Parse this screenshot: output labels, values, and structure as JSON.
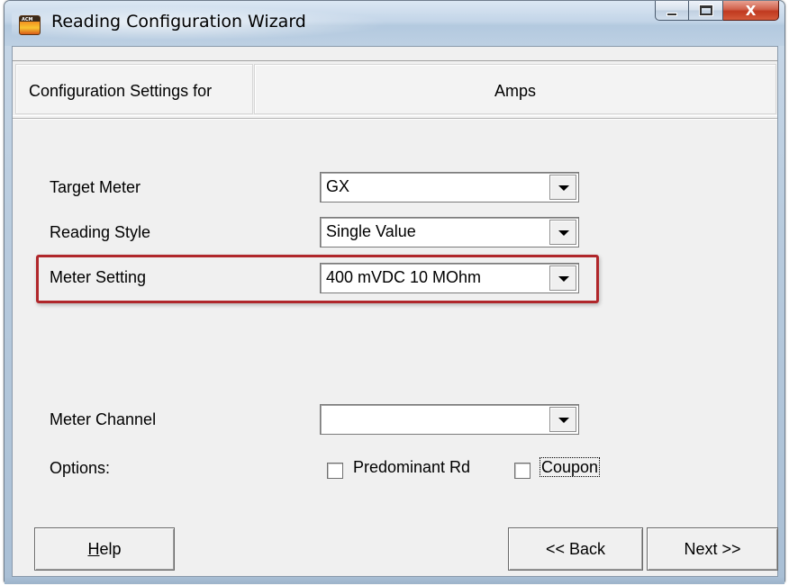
{
  "window": {
    "title": "Reading Configuration Wizard",
    "close_glyph": "X"
  },
  "header": {
    "config_label": "Configuration Settings for",
    "config_target": "Amps"
  },
  "fields": {
    "target_meter": {
      "label": "Target Meter",
      "value": "GX"
    },
    "reading_style": {
      "label": "Reading Style",
      "value": "Single Value"
    },
    "meter_setting": {
      "label": "Meter Setting",
      "value": "400 mVDC 10 MOhm"
    },
    "meter_channel": {
      "label": "Meter Channel",
      "value": ""
    },
    "options": {
      "label": "Options:",
      "predominant": {
        "label": "Predominant Rd",
        "checked": false
      },
      "coupon": {
        "label": "Coupon",
        "checked": false
      }
    }
  },
  "buttons": {
    "help": "Help",
    "back": "<< Back",
    "next": "Next >>"
  },
  "icons": {
    "app": "acm-app-icon",
    "minimize": "minimize-icon",
    "maximize": "maximize-icon",
    "close": "close-icon",
    "dropdown": "chevron-down-icon"
  },
  "colors": {
    "highlight": "#b0272b",
    "close_button": "#c0391f",
    "dialog_bg": "#f0f0f0"
  }
}
